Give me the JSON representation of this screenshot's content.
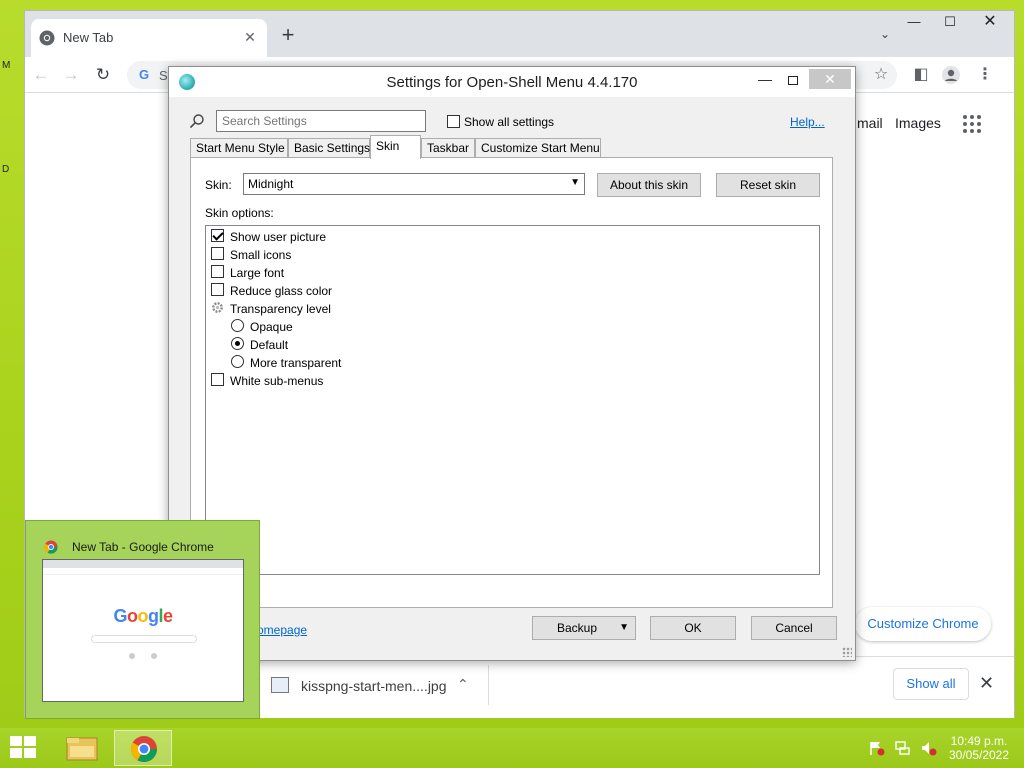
{
  "chrome": {
    "tab_title": "New Tab",
    "omnibox_text": "S",
    "gmail": "mail",
    "images": "Images",
    "customize_chrome": "Customize Chrome",
    "download_filename": "kisspng-start-men....jpg",
    "show_all": "Show all"
  },
  "dialog": {
    "title": "Settings for Open-Shell Menu 4.4.170",
    "search_placeholder": "Search Settings",
    "show_all_settings": "Show all settings",
    "help": "Help...",
    "tabs": [
      "Start Menu Style",
      "Basic Settings",
      "Skin",
      "Taskbar",
      "Customize Start Menu"
    ],
    "active_tab": "Skin",
    "skin_label": "Skin:",
    "skin_value": "Midnight",
    "about_skin": "About this skin",
    "reset_skin": "Reset skin",
    "skin_options_label": "Skin options:",
    "options": [
      {
        "label": "Show user picture",
        "type": "checkbox",
        "checked": true
      },
      {
        "label": "Small icons",
        "type": "checkbox",
        "checked": false
      },
      {
        "label": "Large font",
        "type": "checkbox",
        "checked": false
      },
      {
        "label": "Reduce glass color",
        "type": "checkbox",
        "checked": false
      },
      {
        "label": "Transparency level",
        "type": "group"
      },
      {
        "label": "Opaque",
        "type": "radio",
        "checked": false
      },
      {
        "label": "Default",
        "type": "radio",
        "checked": true
      },
      {
        "label": "More transparent",
        "type": "radio",
        "checked": false
      },
      {
        "label": "White sub-menus",
        "type": "checkbox",
        "checked": false
      }
    ],
    "homepage_link": "omepage",
    "backup": "Backup",
    "ok": "OK",
    "cancel": "Cancel"
  },
  "thumbnail": {
    "title": "New Tab - Google Chrome",
    "preview_logo": "Google"
  },
  "taskbar": {
    "time": "10:49 p.m.",
    "date": "30/05/2022"
  },
  "desktop": {
    "letters": [
      "M",
      "D"
    ]
  },
  "colors": {
    "desktop": "#a8d21c",
    "link": "#0066cc",
    "chrome_blue": "#1a73e8"
  }
}
